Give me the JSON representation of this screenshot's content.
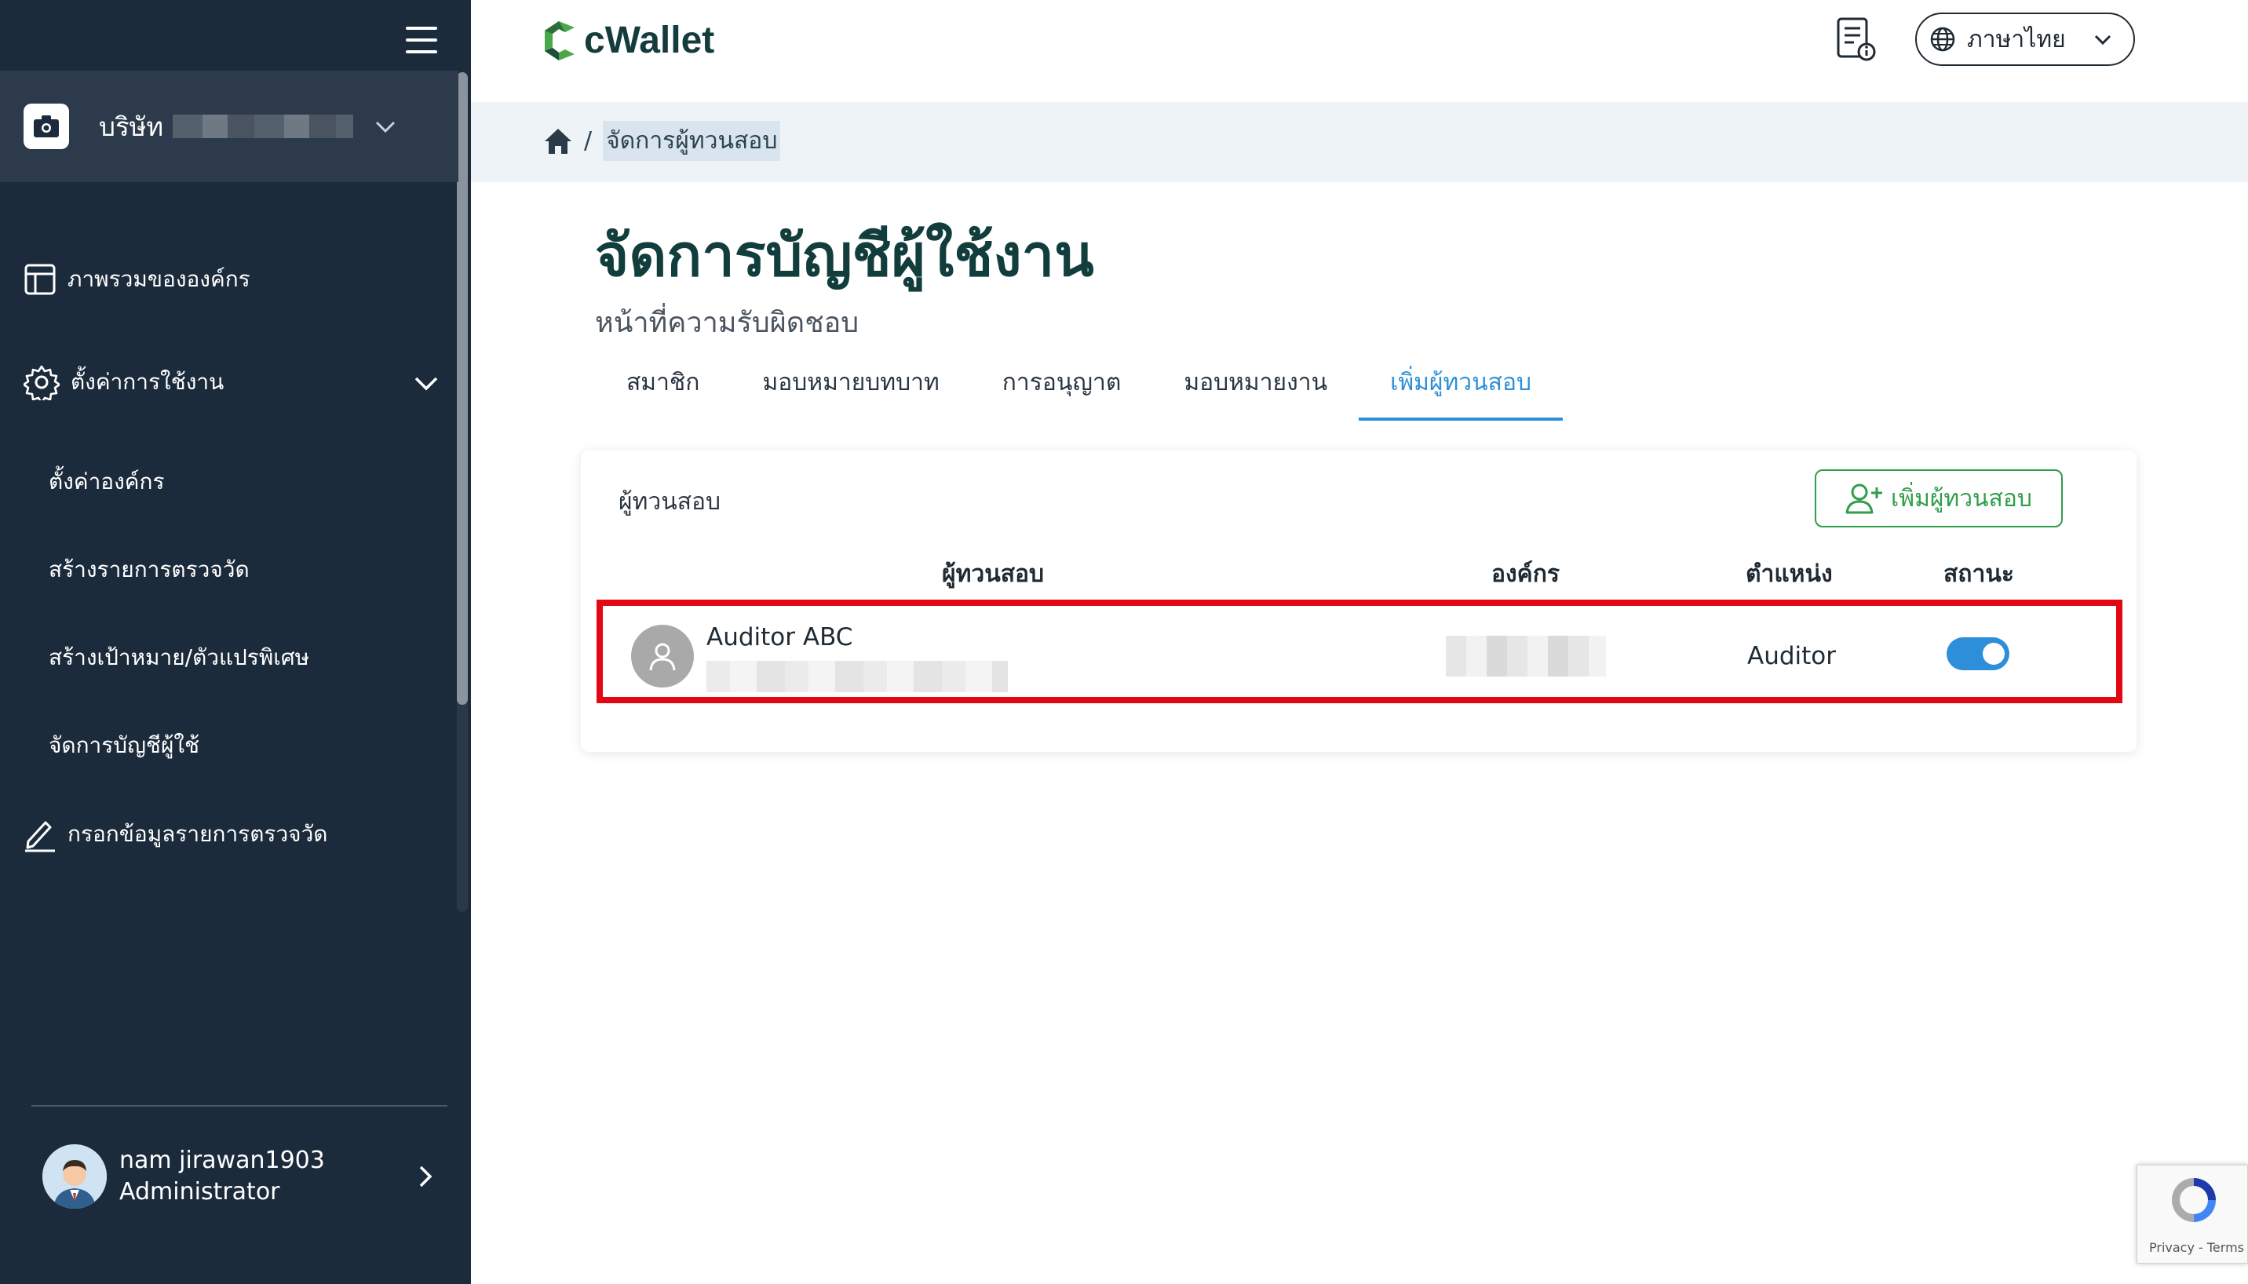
{
  "app": {
    "logo_text": "cWallet"
  },
  "sidebar": {
    "company": {
      "label": "บริษัท"
    },
    "items": [
      {
        "label": "ภาพรวมขององค์กร"
      },
      {
        "label": "ตั้งค่าการใช้งาน"
      },
      {
        "label": "ตั้งค่าองค์กร"
      },
      {
        "label": "สร้างรายการตรวจวัด"
      },
      {
        "label": "สร้างเป้าหมาย/ตัวแปรพิเศษ"
      },
      {
        "label": "จัดการบัญชีผู้ใช้"
      },
      {
        "label": "กรอกข้อมูลรายการตรวจวัด"
      }
    ],
    "user": {
      "name": "nam jirawan1903",
      "role": "Administrator"
    }
  },
  "header": {
    "language": "ภาษาไทย"
  },
  "breadcrumb": {
    "separator": "/",
    "current": "จัดการผู้ทวนสอบ"
  },
  "page": {
    "title": "จัดการบัญชีผู้ใช้งาน",
    "subtitle": "หน้าที่ความรับผิดชอบ",
    "tabs": [
      {
        "label": "สมาชิก"
      },
      {
        "label": "มอบหมายบทบาท"
      },
      {
        "label": "การอนุญาต"
      },
      {
        "label": "มอบหมายงาน"
      },
      {
        "label": "เพิ่มผู้ทวนสอบ"
      }
    ],
    "active_tab": "เพิ่มผู้ทวนสอบ"
  },
  "card": {
    "title": "ผู้ทวนสอบ",
    "add_button": "เพิ่มผู้ทวนสอบ",
    "columns": [
      "ผู้ทวนสอบ",
      "องค์กร",
      "ตำแหน่ง",
      "สถานะ"
    ],
    "rows": [
      {
        "name": "Auditor ABC",
        "position": "Auditor",
        "status_on": true
      }
    ]
  },
  "recaptcha": {
    "text": "Privacy - Terms"
  },
  "colors": {
    "sidebar": "#1c2b3c",
    "accent": "#2d8fd9",
    "green": "#2f9e4a",
    "highlight": "#e30613"
  }
}
